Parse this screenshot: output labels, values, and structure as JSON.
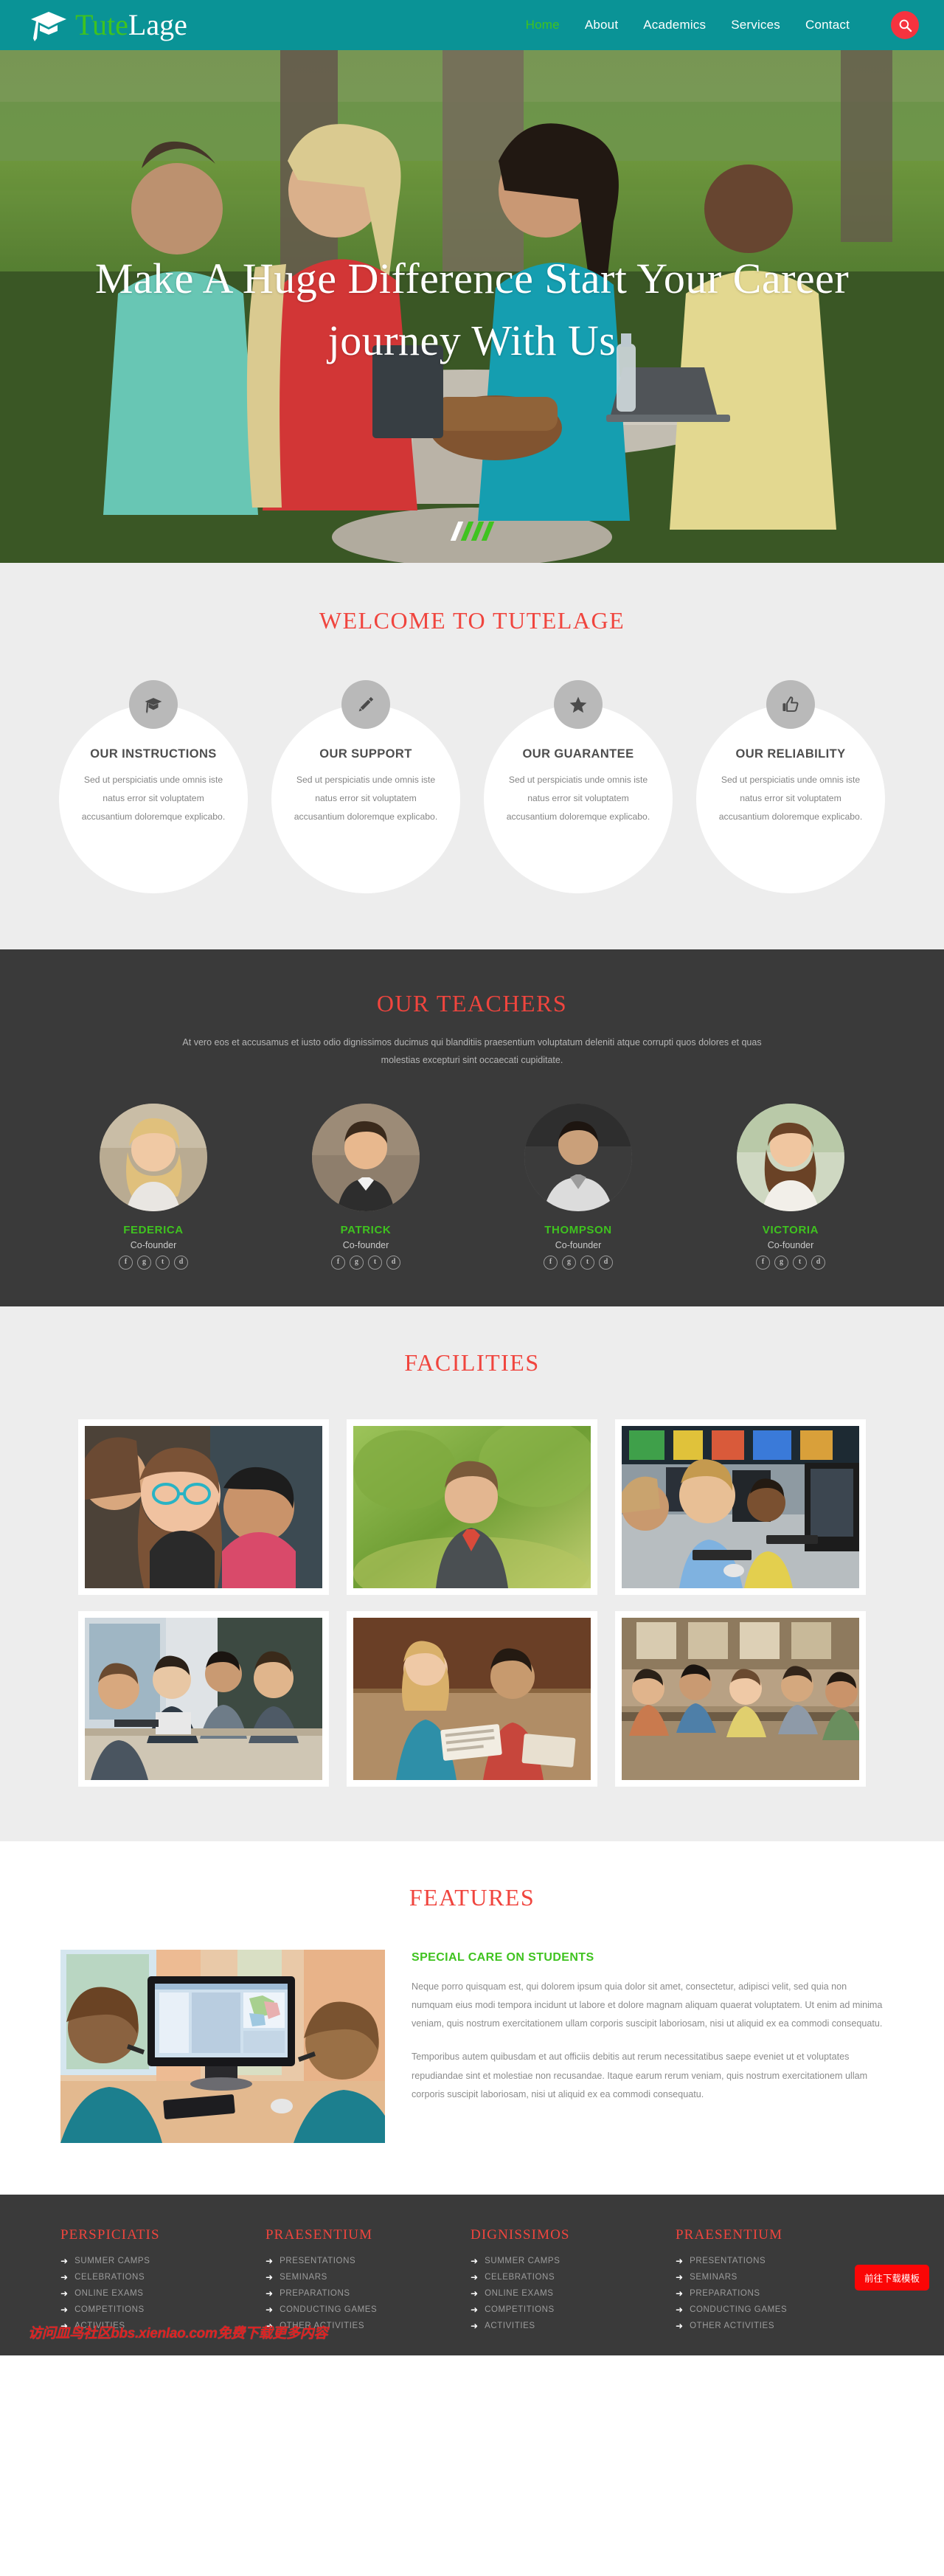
{
  "brand": {
    "name_part1": "Tute",
    "name_part2": "Lage",
    "icon": "graduation-cap-icon"
  },
  "nav": {
    "items": [
      {
        "label": "Home",
        "active": true
      },
      {
        "label": "About",
        "active": false
      },
      {
        "label": "Academics",
        "active": false
      },
      {
        "label": "Services",
        "active": false
      },
      {
        "label": "Contact",
        "active": false
      }
    ],
    "search_icon": "search-icon",
    "accent": "#f5333f",
    "bar_color": "#0a9396",
    "active_color": "#3fc31f"
  },
  "hero": {
    "title": "Make A Huge Difference Start Your Career journey With Us",
    "slides": 4,
    "active_slide": 1
  },
  "welcome": {
    "title": "WELCOME TO TUTELAGE",
    "cards": [
      {
        "icon": "graduation-cap-icon",
        "title": "OUR INSTRUCTIONS",
        "text": "Sed ut perspiciatis unde omnis iste natus error sit voluptatem accusantium doloremque explicabo."
      },
      {
        "icon": "pencil-icon",
        "title": "OUR SUPPORT",
        "text": "Sed ut perspiciatis unde omnis iste natus error sit voluptatem accusantium doloremque explicabo."
      },
      {
        "icon": "star-icon",
        "title": "OUR GUARANTEE",
        "text": "Sed ut perspiciatis unde omnis iste natus error sit voluptatem accusantium doloremque explicabo."
      },
      {
        "icon": "thumbs-up-icon",
        "title": "OUR RELIABILITY",
        "text": "Sed ut perspiciatis unde omnis iste natus error sit voluptatem accusantium doloremque explicabo."
      }
    ]
  },
  "teachers": {
    "title": "OUR TEACHERS",
    "subtitle": "At vero eos et accusamus et iusto odio dignissimos ducimus qui blanditiis praesentium voluptatum deleniti atque corrupti quos dolores et quas molestias excepturi sint occaecati cupiditate.",
    "social": [
      {
        "icon": "facebook-icon",
        "glyph": "f"
      },
      {
        "icon": "google-plus-icon",
        "glyph": "g"
      },
      {
        "icon": "twitter-icon",
        "glyph": "t"
      },
      {
        "icon": "dribbble-icon",
        "glyph": "d"
      }
    ],
    "members": [
      {
        "name": "FEDERICA",
        "role": "Co-founder"
      },
      {
        "name": "PATRICK",
        "role": "Co-founder"
      },
      {
        "name": "THOMPSON",
        "role": "Co-founder"
      },
      {
        "name": "VICTORIA",
        "role": "Co-founder"
      }
    ]
  },
  "facilities": {
    "title": "FACILITIES",
    "items": [
      {
        "alt": "girl-with-glasses-and-classmates"
      },
      {
        "alt": "boy-outdoors-in-green-park"
      },
      {
        "alt": "children-in-computer-lab"
      },
      {
        "alt": "students-at-table-in-library"
      },
      {
        "alt": "students-reading-on-floor"
      },
      {
        "alt": "busy-classroom-with-students"
      }
    ]
  },
  "features": {
    "title": "FEATURES",
    "image_alt": "two-boys-looking-at-desktop-monitor",
    "heading": "SPECIAL CARE ON STUDENTS",
    "paragraphs": [
      "Neque porro quisquam est, qui dolorem ipsum quia dolor sit amet, consectetur, adipisci velit, sed quia non numquam eius modi tempora incidunt ut labore et dolore magnam aliquam quaerat voluptatem. Ut enim ad minima veniam, quis nostrum exercitationem ullam corporis suscipit laboriosam, nisi ut aliquid ex ea commodi consequatu.",
      "Temporibus autem quibusdam et aut officiis debitis aut rerum necessitatibus saepe eveniet ut et voluptates repudiandae sint et molestiae non recusandae. Itaque earum rerum veniam, quis nostrum exercitationem ullam corporis suscipit laboriosam, nisi ut aliquid ex ea commodi consequatu."
    ]
  },
  "footer": {
    "columns": [
      {
        "title": "PERSPICIATIS",
        "links": [
          "SUMMER CAMPS",
          "CELEBRATIONS",
          "ONLINE EXAMS",
          "COMPETITIONS",
          "ACTIVITIES"
        ]
      },
      {
        "title": "PRAESENTIUM",
        "links": [
          "PRESENTATIONS",
          "SEMINARS",
          "PREPARATIONS",
          "CONDUCTING GAMES",
          "OTHER ACTIVITIES"
        ]
      },
      {
        "title": "DIGNISSIMOS",
        "links": [
          "SUMMER CAMPS",
          "CELEBRATIONS",
          "ONLINE EXAMS",
          "COMPETITIONS",
          "ACTIVITIES"
        ]
      },
      {
        "title": "PRAESENTIUM",
        "links": [
          "PRESENTATIONS",
          "SEMINARS",
          "PREPARATIONS",
          "CONDUCTING GAMES",
          "OTHER ACTIVITIES"
        ]
      }
    ],
    "arrow_icon": "arrow-right-icon"
  },
  "overlay": {
    "download_button": "前往下载模板",
    "watermark": "访问皿鸟社区bbs.xienlao.com免费下载更多内容"
  }
}
